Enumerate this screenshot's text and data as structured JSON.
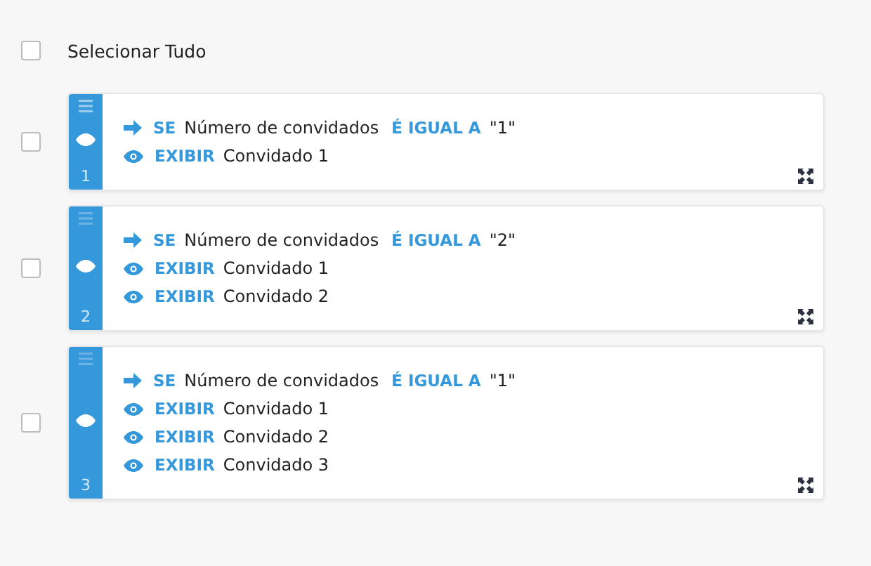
{
  "select_all": {
    "label": "Selecionar Tudo",
    "checked": false
  },
  "rules": [
    {
      "number": "1",
      "checked": false,
      "condition": {
        "keyword": "SE",
        "field": "Número de convidados",
        "operator": "É IGUAL A",
        "value": "\"1\""
      },
      "actions": [
        {
          "keyword": "EXIBIR",
          "target": "Convidado 1"
        }
      ]
    },
    {
      "number": "2",
      "checked": false,
      "condition": {
        "keyword": "SE",
        "field": "Número de convidados",
        "operator": "É IGUAL A",
        "value": "\"2\""
      },
      "actions": [
        {
          "keyword": "EXIBIR",
          "target": "Convidado 1"
        },
        {
          "keyword": "EXIBIR",
          "target": "Convidado 2"
        }
      ]
    },
    {
      "number": "3",
      "checked": false,
      "condition": {
        "keyword": "SE",
        "field": "Número de convidados",
        "operator": "É IGUAL A",
        "value": "\"1\""
      },
      "actions": [
        {
          "keyword": "EXIBIR",
          "target": "Convidado 1"
        },
        {
          "keyword": "EXIBIR",
          "target": "Convidado 2"
        },
        {
          "keyword": "EXIBIR",
          "target": "Convidado 3"
        }
      ]
    }
  ]
}
